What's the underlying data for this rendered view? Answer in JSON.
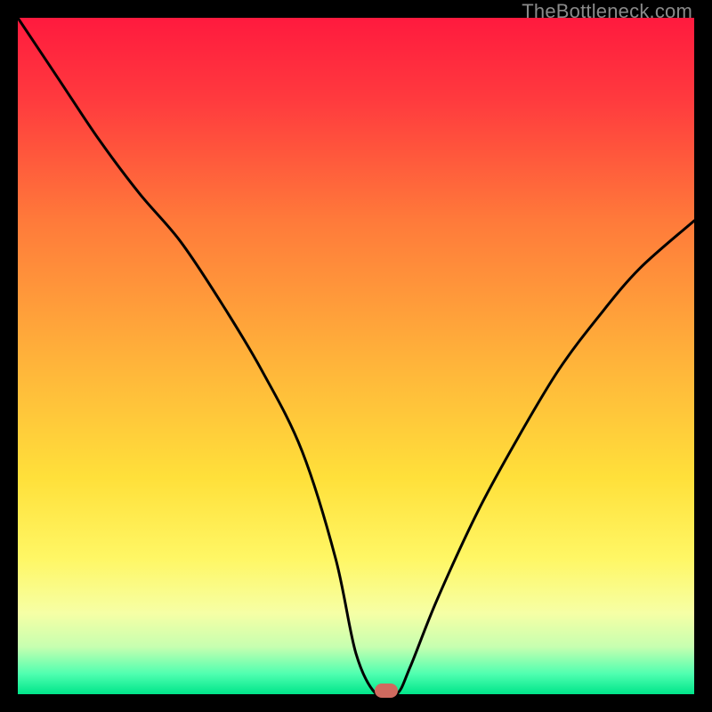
{
  "watermark": {
    "text": "TheBottleneck.com"
  },
  "chart_data": {
    "type": "line",
    "title": "",
    "xlabel": "",
    "ylabel": "",
    "xlim": [
      0,
      100
    ],
    "ylim": [
      0,
      100
    ],
    "grid": false,
    "legend": false,
    "background_gradient": {
      "stops": [
        {
          "offset": 0.0,
          "color": "#ff1a3e"
        },
        {
          "offset": 0.12,
          "color": "#ff3a3e"
        },
        {
          "offset": 0.3,
          "color": "#ff7a3a"
        },
        {
          "offset": 0.5,
          "color": "#ffb13a"
        },
        {
          "offset": 0.68,
          "color": "#ffe03a"
        },
        {
          "offset": 0.8,
          "color": "#fff765"
        },
        {
          "offset": 0.88,
          "color": "#f6ffa5"
        },
        {
          "offset": 0.93,
          "color": "#c7ffb0"
        },
        {
          "offset": 0.97,
          "color": "#4fffb0"
        },
        {
          "offset": 1.0,
          "color": "#00e58a"
        }
      ]
    },
    "series": [
      {
        "name": "bottleneck-curve",
        "color": "#000000",
        "x": [
          0,
          6,
          12,
          18,
          24,
          30,
          36,
          42,
          47,
          50,
          53,
          56,
          58,
          62,
          68,
          74,
          80,
          86,
          92,
          100
        ],
        "values": [
          100,
          91,
          82,
          74,
          67,
          58,
          48,
          36,
          20,
          6,
          0,
          0,
          4,
          14,
          27,
          38,
          48,
          56,
          63,
          70
        ]
      }
    ],
    "marker": {
      "x": 54.5,
      "y": 0,
      "color": "#cf6a5f"
    }
  }
}
